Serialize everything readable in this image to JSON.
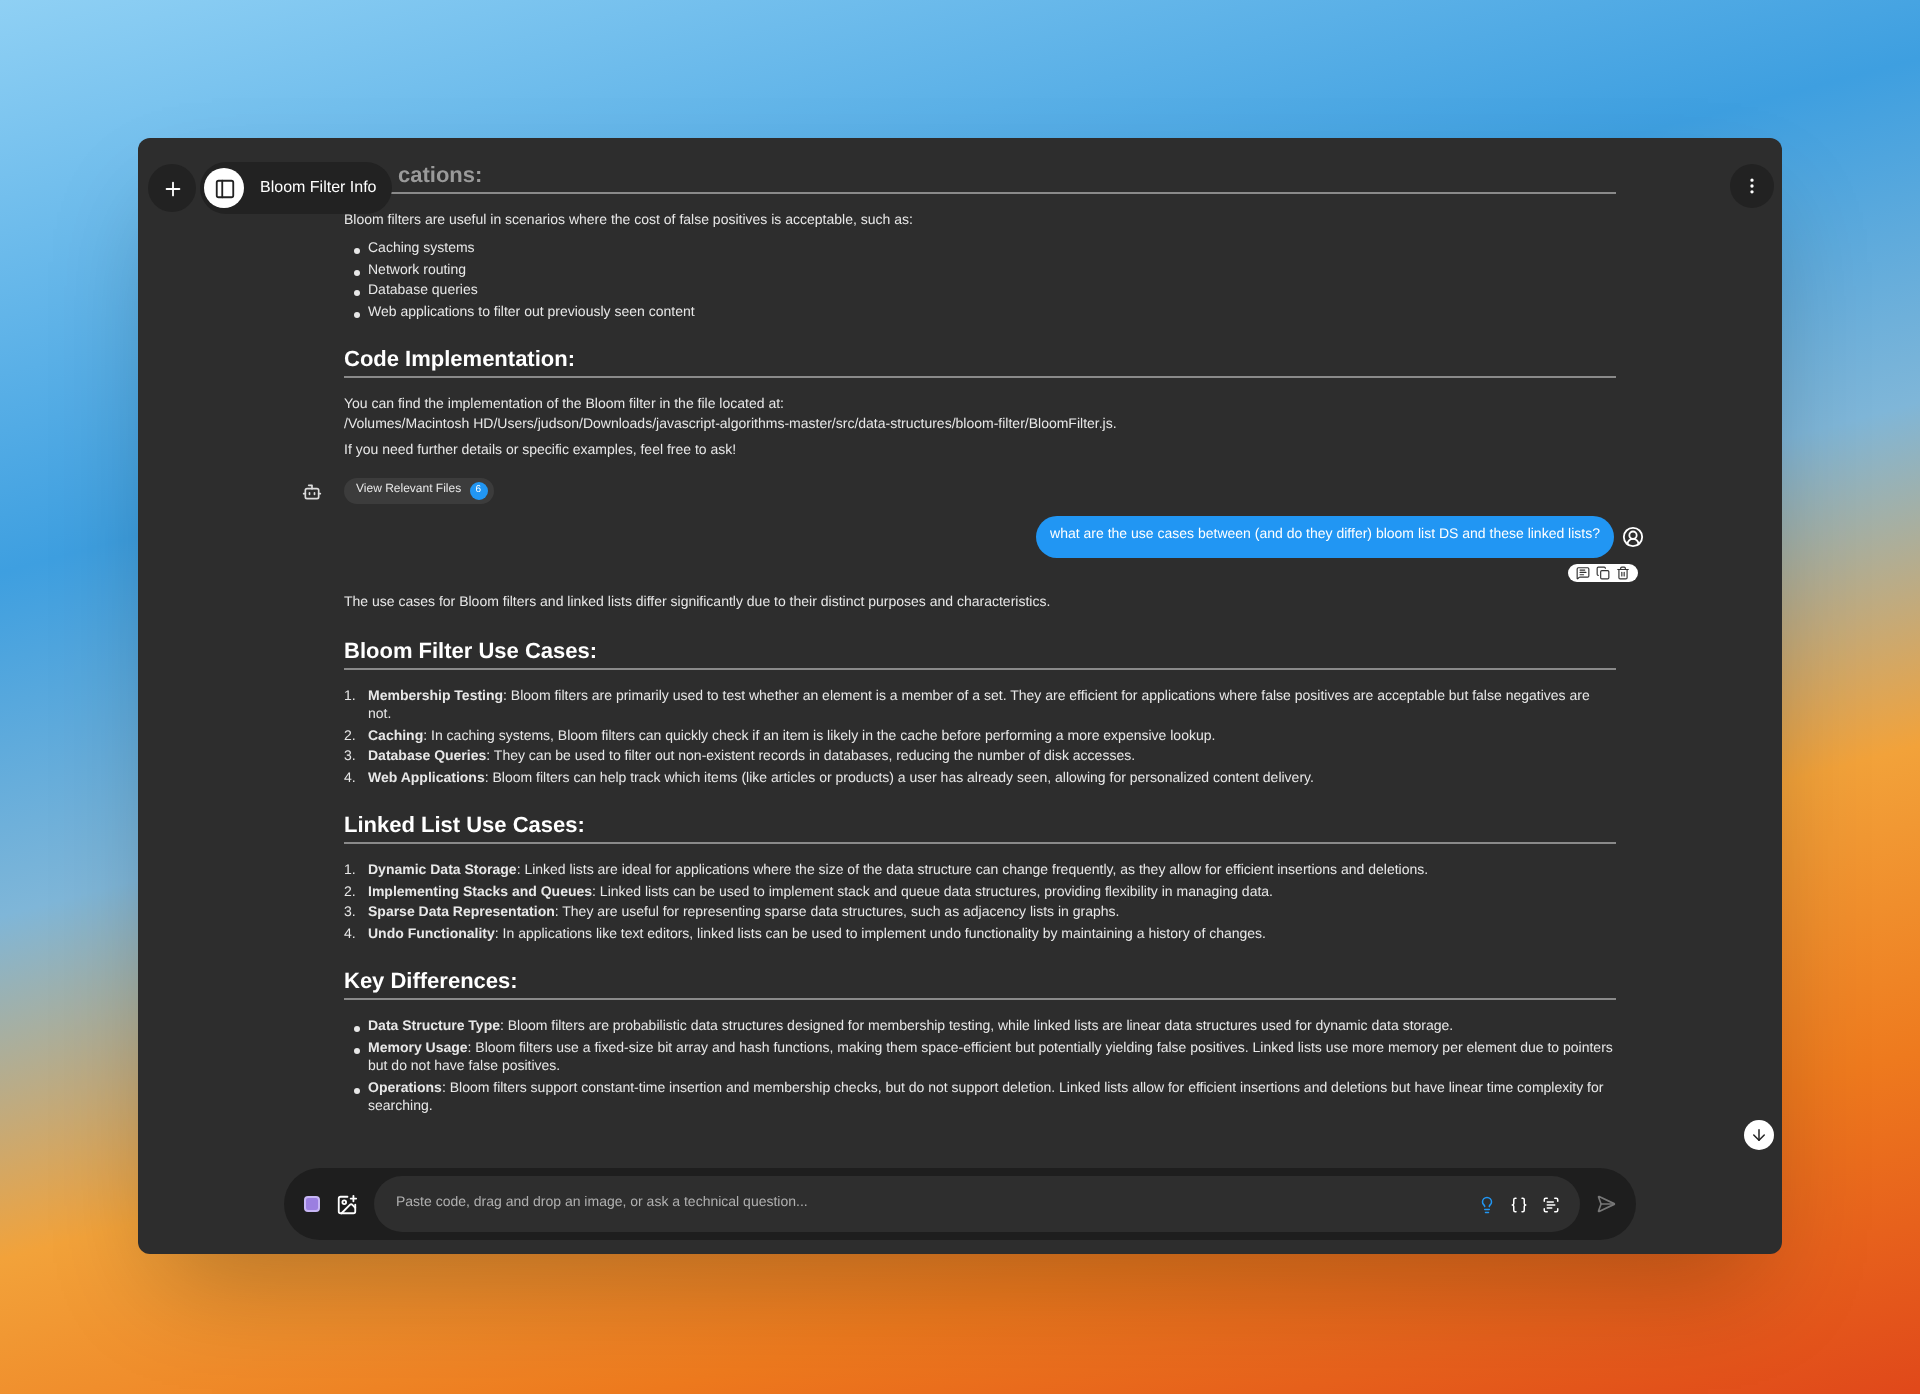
{
  "header": {
    "title": "Bloom Filter Info"
  },
  "messages": [
    {
      "kind": "assistant",
      "blocks": [
        {
          "kind": "partial_heading",
          "text": "cations:"
        },
        {
          "kind": "paragraph",
          "lines": [
            "Bloom filters are useful in scenarios where the cost of false positives is acceptable, such as:"
          ]
        },
        {
          "kind": "bullets",
          "items": [
            {
              "text": "Caching systems"
            },
            {
              "text": "Network routing"
            },
            {
              "text": "Database queries"
            },
            {
              "text": "Web applications to filter out previously seen content"
            }
          ]
        },
        {
          "kind": "heading",
          "text": "Code Implementation:"
        },
        {
          "kind": "paragraph",
          "lines": [
            "You can find the implementation of the Bloom filter in the file located at:",
            "/Volumes/Macintosh HD/Users/judson/Downloads/javascript-algorithms-master/src/data-structures/bloom-filter/BloomFilter.js."
          ]
        },
        {
          "kind": "paragraph",
          "lines": [
            "If you need further details or specific examples, feel free to ask!"
          ]
        }
      ],
      "files_button": {
        "label": "View Relevant Files",
        "count": "6"
      }
    },
    {
      "kind": "user",
      "text": "what are the use cases between (and do they differ) bloom list DS and these linked lists?"
    },
    {
      "kind": "assistant",
      "blocks": [
        {
          "kind": "paragraph",
          "lines": [
            "The use cases for Bloom filters and linked lists differ significantly due to their distinct purposes and characteristics."
          ]
        },
        {
          "kind": "heading",
          "text": "Bloom Filter Use Cases:"
        },
        {
          "kind": "numbered",
          "items": [
            {
              "marker": "1.",
              "text": "**Membership Testing**: Bloom filters are primarily used to test whether an element is a member of a set. They are efficient for applications where false positives are acceptable but false negatives are not."
            },
            {
              "marker": "2.",
              "text": "**Caching**: In caching systems, Bloom filters can quickly check if an item is likely in the cache before performing a more expensive lookup."
            },
            {
              "marker": "3.",
              "text": "**Database Queries**: They can be used to filter out non-existent records in databases, reducing the number of disk accesses."
            },
            {
              "marker": "4.",
              "text": "**Web Applications**: Bloom filters can help track which items (like articles or products) a user has already seen, allowing for personalized content delivery."
            }
          ]
        },
        {
          "kind": "heading",
          "text": "Linked List Use Cases:"
        },
        {
          "kind": "numbered",
          "items": [
            {
              "marker": "1.",
              "text": "**Dynamic Data Storage**: Linked lists are ideal for applications where the size of the data structure can change frequently, as they allow for efficient insertions and deletions."
            },
            {
              "marker": "2.",
              "text": "**Implementing Stacks and Queues**: Linked lists can be used to implement stack and queue data structures, providing flexibility in managing data."
            },
            {
              "marker": "3.",
              "text": "**Sparse Data Representation**: They are useful for representing sparse data structures, such as adjacency lists in graphs."
            },
            {
              "marker": "4.",
              "text": "**Undo Functionality**: In applications like text editors, linked lists can be used to implement undo functionality by maintaining a history of changes."
            }
          ]
        },
        {
          "kind": "heading",
          "text": "Key Differences:"
        },
        {
          "kind": "bullets",
          "items": [
            {
              "text": "**Data Structure Type**: Bloom filters are probabilistic data structures designed for membership testing, while linked lists are linear data structures used for dynamic data storage."
            },
            {
              "text": "**Memory Usage**: Bloom filters use a fixed-size bit array and hash functions, making them space-efficient but potentially yielding false positives. Linked lists use more memory per element due to pointers but do not have false positives."
            },
            {
              "text": "**Operations**: Bloom filters support constant-time insertion and membership checks, but do not support deletion. Linked lists allow for efficient insertions and deletions but have linear time complexity for searching."
            }
          ]
        }
      ]
    }
  ],
  "composer": {
    "placeholder": "Paste code, drag and drop an image, or ask a technical question..."
  }
}
